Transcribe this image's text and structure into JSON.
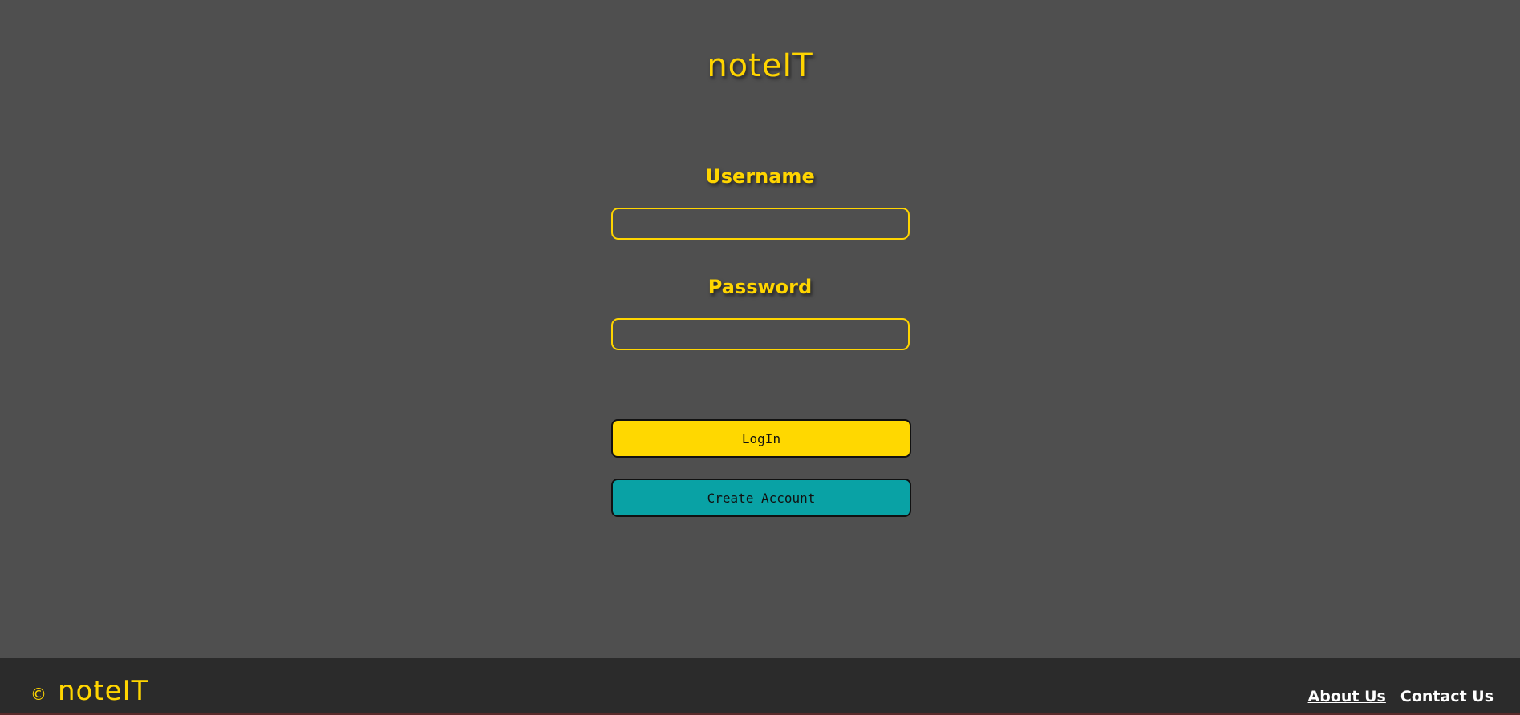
{
  "app": {
    "title": "noteIT",
    "accent_color": "#ffd500",
    "background_color": "#4f4f4f",
    "footer_color": "#2b2b2b"
  },
  "form": {
    "username_label": "Username",
    "username_value": "",
    "password_label": "Password",
    "password_value": "",
    "login_label": "LogIn",
    "login_color": "#ffd800",
    "create_account_label": "Create Account",
    "create_account_color": "#09a2a5"
  },
  "footer": {
    "copyright_icon": "copyright-icon",
    "copyright_symbol": "©",
    "brand": "noteIT",
    "links": [
      {
        "label": "About Us"
      },
      {
        "label": "Contact Us"
      }
    ]
  }
}
